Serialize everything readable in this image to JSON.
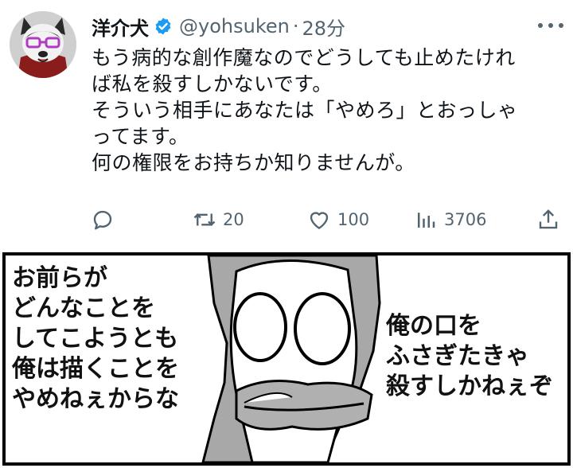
{
  "tweet": {
    "display_name": "洋介犬",
    "handle": "@yohsuken",
    "separator": "·",
    "time": "28分",
    "lines": [
      "もう病的な創作魔なのでどうしても止めたけれ",
      "ば私を殺すしかないです。",
      "そういう相手にあなたは「やめろ」とおっしゃ",
      "ってます。",
      "何の権限をお持ちか知りませんが。"
    ],
    "actions": {
      "reply_icon": "reply-icon",
      "retweet_icon": "retweet-icon",
      "retweet_count": "20",
      "like_icon": "heart-icon",
      "like_count": "100",
      "views_icon": "views-icon",
      "views_count": "3706",
      "share_icon": "share-icon"
    },
    "verified_color": "#1d9bf0",
    "muted_color": "#536471"
  },
  "comic": {
    "left_lines": [
      "お前らが",
      "どんなことを",
      "してこようとも",
      "俺は描くことを",
      "やめねぇからな"
    ],
    "right_lines": [
      "俺の口を",
      "ふさぎたきゃ",
      "殺すしかねぇぞ"
    ]
  }
}
